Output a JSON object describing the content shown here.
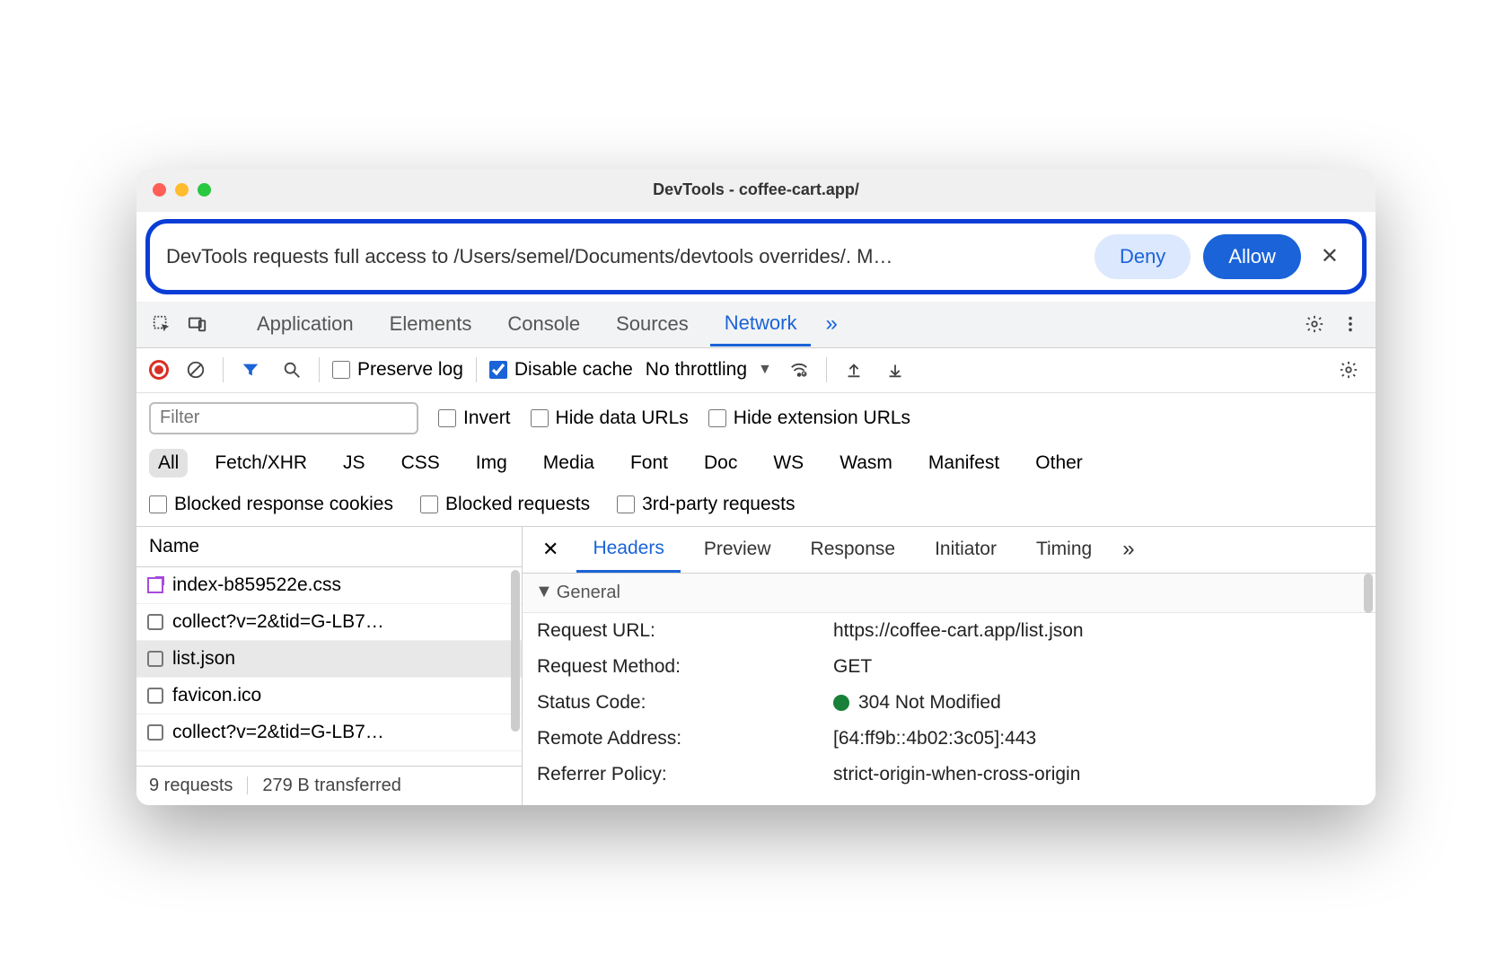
{
  "window": {
    "title": "DevTools - coffee-cart.app/"
  },
  "permission": {
    "text": "DevTools requests full access to /Users/semel/Documents/devtools overrides/. M…",
    "deny": "Deny",
    "allow": "Allow"
  },
  "panels": {
    "application": "Application",
    "elements": "Elements",
    "console": "Console",
    "sources": "Sources",
    "network": "Network"
  },
  "network_toolbar": {
    "preserve_log": "Preserve log",
    "disable_cache": "Disable cache",
    "throttling": "No throttling"
  },
  "filters": {
    "placeholder": "Filter",
    "invert": "Invert",
    "hide_data_urls": "Hide data URLs",
    "hide_ext_urls": "Hide extension URLs"
  },
  "types": [
    "All",
    "Fetch/XHR",
    "JS",
    "CSS",
    "Img",
    "Media",
    "Font",
    "Doc",
    "WS",
    "Wasm",
    "Manifest",
    "Other"
  ],
  "options": {
    "blocked_cookies": "Blocked response cookies",
    "blocked_requests": "Blocked requests",
    "third_party": "3rd-party requests"
  },
  "list": {
    "column": "Name",
    "items": [
      {
        "name": "index-b859522e.css",
        "kind": "css"
      },
      {
        "name": "collect?v=2&tid=G-LB7…",
        "kind": "req"
      },
      {
        "name": "list.json",
        "kind": "req",
        "selected": true
      },
      {
        "name": "favicon.ico",
        "kind": "req"
      },
      {
        "name": "collect?v=2&tid=G-LB7…",
        "kind": "req"
      }
    ],
    "footer_requests": "9 requests",
    "footer_transferred": "279 B transferred"
  },
  "detail": {
    "tabs": {
      "headers": "Headers",
      "preview": "Preview",
      "response": "Response",
      "initiator": "Initiator",
      "timing": "Timing"
    },
    "section": "General",
    "rows": {
      "request_url_k": "Request URL:",
      "request_url_v": "https://coffee-cart.app/list.json",
      "request_method_k": "Request Method:",
      "request_method_v": "GET",
      "status_code_k": "Status Code:",
      "status_code_v": "304 Not Modified",
      "remote_addr_k": "Remote Address:",
      "remote_addr_v": "[64:ff9b::4b02:3c05]:443",
      "referrer_policy_k": "Referrer Policy:",
      "referrer_policy_v": "strict-origin-when-cross-origin"
    }
  }
}
